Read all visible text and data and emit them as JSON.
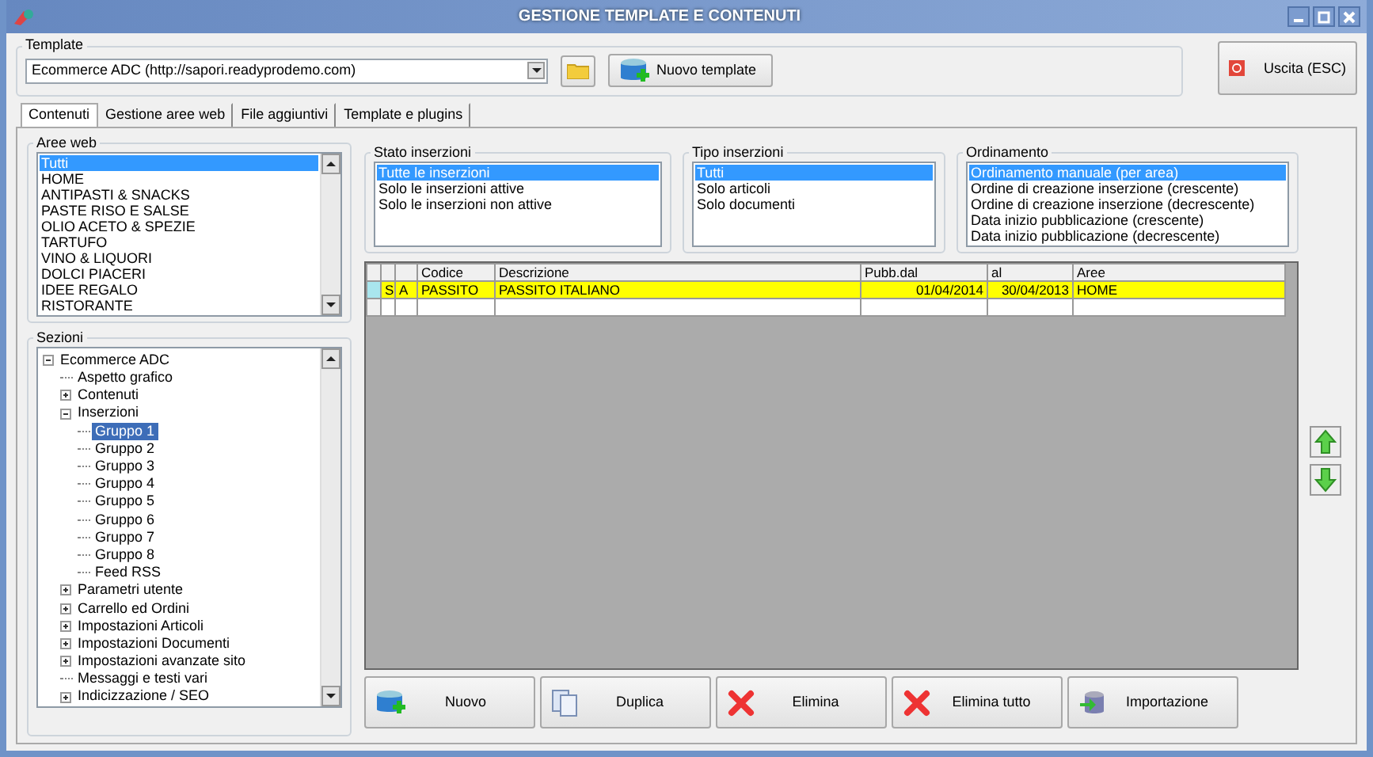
{
  "window": {
    "title": "GESTIONE TEMPLATE E CONTENUTI"
  },
  "template": {
    "label": "Template",
    "value": "Ecommerce ADC (http://sapori.readyprodemo.com)",
    "new_button": "Nuovo template"
  },
  "exit_button": "Uscita (ESC)",
  "tabs": [
    {
      "label": "Contenuti",
      "selected": true
    },
    {
      "label": "Gestione aree web",
      "selected": false
    },
    {
      "label": "File aggiuntivi",
      "selected": false
    },
    {
      "label": "Template e plugins",
      "selected": false
    }
  ],
  "aree_web": {
    "label": "Aree web",
    "items": [
      {
        "label": "Tutti",
        "selected": true
      },
      {
        "label": "HOME",
        "selected": false
      },
      {
        "label": "ANTIPASTI & SNACKS",
        "selected": false
      },
      {
        "label": "PASTE RISO E SALSE",
        "selected": false
      },
      {
        "label": "OLIO ACETO & SPEZIE",
        "selected": false
      },
      {
        "label": "TARTUFO",
        "selected": false
      },
      {
        "label": "VINO & LIQUORI",
        "selected": false
      },
      {
        "label": "DOLCI PIACERI",
        "selected": false
      },
      {
        "label": "IDEE REGALO",
        "selected": false
      },
      {
        "label": "RISTORANTE",
        "selected": false
      }
    ]
  },
  "sezioni": {
    "label": "Sezioni",
    "tree": [
      {
        "label": "Ecommerce ADC",
        "selected": false,
        "expanded": true,
        "children": [
          {
            "label": "Aspetto grafico",
            "selected": false
          },
          {
            "label": "Contenuti",
            "selected": false,
            "expanded": false
          },
          {
            "label": "Inserzioni",
            "selected": false,
            "expanded": true,
            "children": [
              {
                "label": "Gruppo 1",
                "selected": true
              },
              {
                "label": "Gruppo 2",
                "selected": false
              },
              {
                "label": "Gruppo 3",
                "selected": false
              },
              {
                "label": "Gruppo 4",
                "selected": false
              },
              {
                "label": "Gruppo 5",
                "selected": false
              },
              {
                "label": "Gruppo 6",
                "selected": false
              },
              {
                "label": "Gruppo 7",
                "selected": false
              },
              {
                "label": "Gruppo 8",
                "selected": false
              },
              {
                "label": "Feed RSS",
                "selected": false
              }
            ]
          },
          {
            "label": "Parametri utente",
            "selected": false,
            "expanded": false
          },
          {
            "label": "Carrello ed Ordini",
            "selected": false,
            "expanded": false
          },
          {
            "label": "Impostazioni Articoli",
            "selected": false,
            "expanded": false
          },
          {
            "label": "Impostazioni Documenti",
            "selected": false,
            "expanded": false
          },
          {
            "label": "Impostazioni avanzate sito",
            "selected": false,
            "expanded": false
          },
          {
            "label": "Messaggi e testi vari",
            "selected": false
          },
          {
            "label": "Indicizzazione / SEO",
            "selected": false,
            "expanded": false
          }
        ]
      }
    ]
  },
  "filters": [
    {
      "label": "Stato inserzioni",
      "items": [
        {
          "label": "Tutte le inserzioni",
          "selected": true
        },
        {
          "label": "Solo le inserzioni attive",
          "selected": false
        },
        {
          "label": "Solo le inserzioni non attive",
          "selected": false
        }
      ]
    },
    {
      "label": "Tipo inserzioni",
      "items": [
        {
          "label": "Tutti",
          "selected": true
        },
        {
          "label": "Solo articoli",
          "selected": false
        },
        {
          "label": "Solo documenti",
          "selected": false
        }
      ]
    },
    {
      "label": "Ordinamento",
      "items": [
        {
          "label": "Ordinamento manuale (per area)",
          "selected": true
        },
        {
          "label": "Ordine di creazione inserzione (crescente)",
          "selected": false
        },
        {
          "label": "Ordine di creazione inserzione (decrescente)",
          "selected": false
        },
        {
          "label": "Data inizio pubblicazione (crescente)",
          "selected": false
        },
        {
          "label": "Data inizio pubblicazione (decrescente)",
          "selected": false
        }
      ]
    }
  ],
  "grid": {
    "columns": [
      "Codice",
      "Descrizione",
      "Pubb.dal",
      "al",
      "Aree"
    ],
    "rows": [
      {
        "flag_1": "S",
        "flag_2": "A",
        "codice": "PASSITO",
        "descrizione": "PASSITO ITALIANO",
        "pubb_dal": "01/04/2014",
        "al": "30/04/2013",
        "aree": "HOME",
        "selected": true,
        "highlighted": true
      }
    ]
  },
  "actions": [
    {
      "label": "Nuovo",
      "kind": "new"
    },
    {
      "label": "Duplica",
      "kind": "duplicate"
    },
    {
      "label": "Elimina",
      "kind": "delete"
    },
    {
      "label": "Elimina tutto",
      "kind": "delete"
    },
    {
      "label": "Importazione",
      "kind": "import"
    }
  ]
}
